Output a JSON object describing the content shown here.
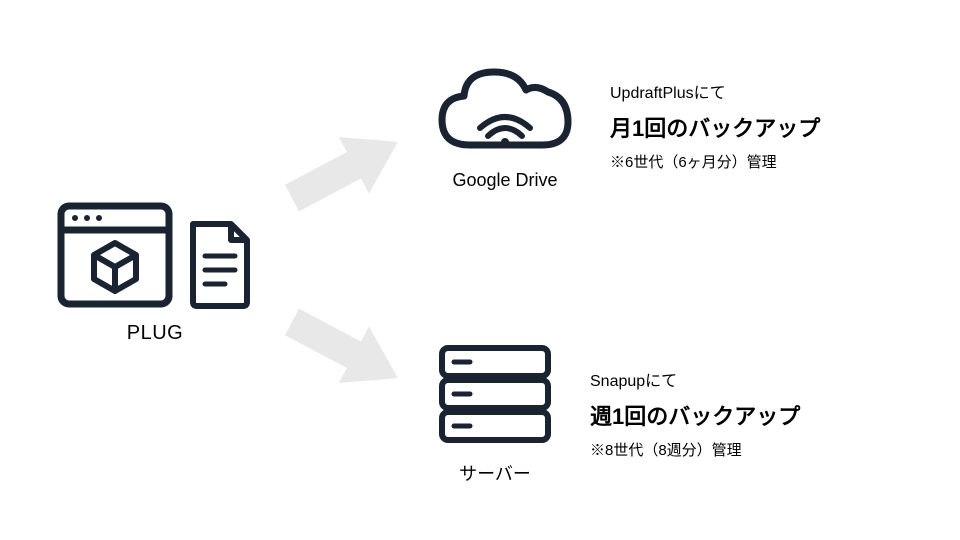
{
  "source": {
    "label": "PLUG"
  },
  "destinations": [
    {
      "iconLabel": "Google Drive",
      "subtitle": "UpdraftPlusにて",
      "title": "月1回のバックアップ",
      "note": "※6世代（6ヶ月分）管理"
    },
    {
      "iconLabel": "サーバー",
      "subtitle": "Snapupにて",
      "title": "週1回のバックアップ",
      "note": "※8世代（8週分）管理"
    }
  ]
}
